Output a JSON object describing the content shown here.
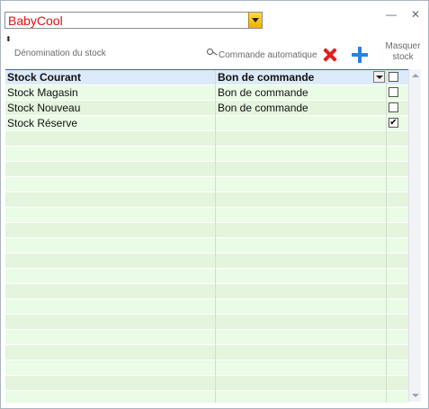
{
  "store": {
    "selected": "BabyCool",
    "dropdown_icon": "chevron-down-icon",
    "accent": "#e01010"
  },
  "window_controls": {
    "minimize": "—",
    "close": "✕"
  },
  "columns": {
    "sort_glyph": "⬍",
    "name": "Dénomination du stock",
    "auto_order": "Commande automatique",
    "auto_order_icon": "key-icon",
    "hide_line1": "Masquer",
    "hide_line2": "stock"
  },
  "toolbar": {
    "delete_icon": "red-x-icon",
    "add_icon": "blue-plus-icon"
  },
  "rows": [
    {
      "name": "Stock Courant",
      "order_mode": "Bon de commande",
      "hide": false,
      "selected": true
    },
    {
      "name": "Stock Magasin",
      "order_mode": "Bon de commande",
      "hide": false
    },
    {
      "name": "Stock Nouveau",
      "order_mode": "Bon de commande",
      "hide": false
    },
    {
      "name": "Stock Réserve",
      "order_mode": "",
      "hide": true
    }
  ],
  "empty_rows": 18
}
